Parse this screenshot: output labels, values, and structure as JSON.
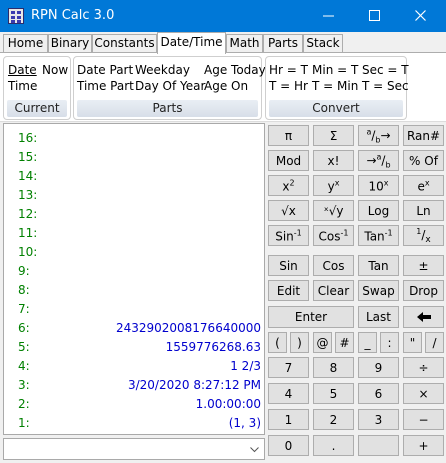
{
  "window": {
    "title": "RPN Calc 3.0"
  },
  "tabs": [
    "Home",
    "Binary",
    "Constants",
    "Date/Time",
    "Math",
    "Parts",
    "Stack"
  ],
  "active_tab": "Date/Time",
  "ribbon": {
    "current": {
      "items": [
        "Date",
        "Now",
        "Time"
      ],
      "caption": "Current"
    },
    "parts": {
      "items": [
        "Date Part",
        "Weekday",
        "Age Today",
        "Time Part",
        "Day Of Year",
        "Age On"
      ],
      "caption": "Parts"
    },
    "convert": {
      "items": [
        "Hr = T",
        "Min = T",
        "Sec = T",
        "T = Hr",
        "T = Min",
        "T = Sec"
      ],
      "caption": "Convert"
    }
  },
  "stack": [
    {
      "label": "16:",
      "value": ""
    },
    {
      "label": "15:",
      "value": ""
    },
    {
      "label": "14:",
      "value": ""
    },
    {
      "label": "13:",
      "value": ""
    },
    {
      "label": "12:",
      "value": ""
    },
    {
      "label": "11:",
      "value": ""
    },
    {
      "label": "10:",
      "value": ""
    },
    {
      "label": "9:",
      "value": ""
    },
    {
      "label": "8:",
      "value": ""
    },
    {
      "label": "7:",
      "value": ""
    },
    {
      "label": "6:",
      "value": "2432902008176640000"
    },
    {
      "label": "5:",
      "value": "1559776268.63"
    },
    {
      "label": "4:",
      "value": "1 2/3"
    },
    {
      "label": "3:",
      "value": "3/20/2020 8:27:12 PM"
    },
    {
      "label": "2:",
      "value": "1.00:00:00"
    },
    {
      "label": "1:",
      "value": "(1, 3)"
    }
  ],
  "entry": {
    "value": ""
  },
  "keypad": {
    "pi": "π",
    "sum": "Σ",
    "frac_a": "a",
    "frac_b": "b",
    "frac_arrow": "→",
    "rand": "Ran#",
    "mod": "Mod",
    "fact": "x!",
    "dec_arrow": "→",
    "dec_a": "a",
    "dec_b": "b",
    "pct": "% Of",
    "x": "x",
    "two": "2",
    "y": "y",
    "ten": "10",
    "e": "e",
    "sqrt": "√x",
    "root": "ˣ√y",
    "log": "Log",
    "ln": "Ln",
    "sin_inv": "Sin",
    "cos_inv": "Cos",
    "tan_inv": "Tan",
    "neg1": "-1",
    "recip_1": "1",
    "recip_x": "x",
    "sin": "Sin",
    "cos": "Cos",
    "tan": "Tan",
    "plusminus": "±",
    "edit": "Edit",
    "clear": "Clear",
    "swap": "Swap",
    "drop": "Drop",
    "enter": "Enter",
    "last": "Last",
    "backspace": "🡐",
    "lparen": "(",
    "rparen": ")",
    "at": "@",
    "hash": "#",
    "underscore": "_",
    "colon": ":",
    "quote": "\"",
    "slash": "/",
    "d7": "7",
    "d8": "8",
    "d9": "9",
    "div": "÷",
    "d4": "4",
    "d5": "5",
    "d6": "6",
    "mul": "×",
    "d1": "1",
    "d2": "2",
    "d3": "3",
    "sub": "−",
    "d0": "0",
    "dot": ".",
    "blank": "",
    "add": "+"
  }
}
